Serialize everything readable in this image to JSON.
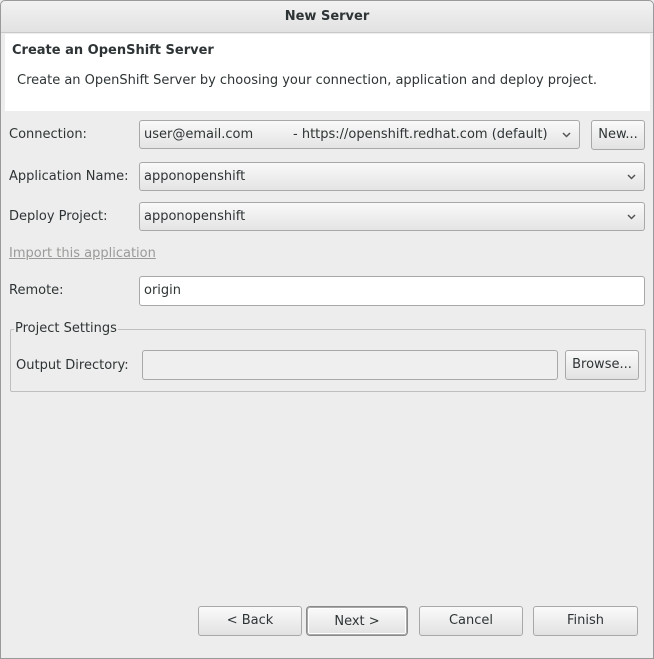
{
  "window": {
    "title": "New Server"
  },
  "banner": {
    "title": "Create an OpenShift Server",
    "description": "Create an OpenShift Server by choosing your connection, application and deploy project."
  },
  "connection": {
    "label": "Connection:",
    "user": "user@email.com",
    "url": "- https://openshift.redhat.com (default)",
    "new_button": "New..."
  },
  "application": {
    "label": "Application Name:",
    "value": "apponopenshift"
  },
  "deploy": {
    "label": "Deploy Project:",
    "value": "apponopenshift"
  },
  "import_link": "Import this application",
  "remote": {
    "label": "Remote:",
    "value": "origin"
  },
  "project_settings": {
    "title": "Project Settings",
    "output_label": "Output Directory:",
    "output_value": "",
    "browse_button": "Browse..."
  },
  "footer": {
    "back": "< Back",
    "next": "Next >",
    "cancel": "Cancel",
    "finish": "Finish"
  },
  "icons": {
    "dropdown": "chevron-down-icon"
  }
}
